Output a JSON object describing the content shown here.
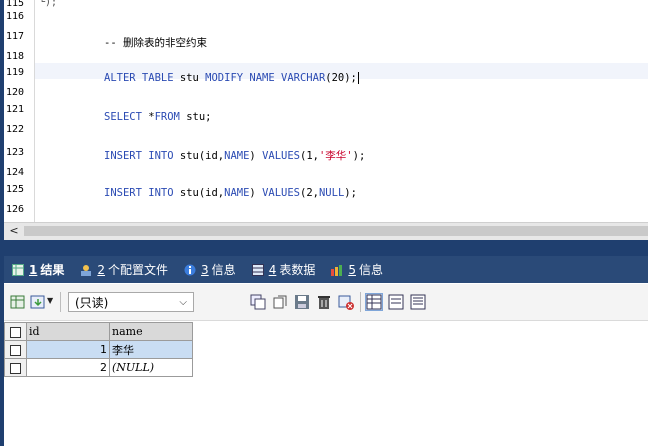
{
  "editor": {
    "line_numbers": [
      "115",
      "116",
      "117",
      "118",
      "119",
      "120",
      "121",
      "122",
      "123",
      "124",
      "125",
      "126"
    ],
    "fold_marker": "└);",
    "comment": "-- 删除表的非空约束",
    "alter": {
      "kw1": "ALTER TABLE",
      "t1": " stu ",
      "kw2": "MODIFY NAME VARCHAR",
      "t2": "(20);"
    },
    "select": {
      "kw": "SELECT",
      "t": " *",
      "kw2": "FROM",
      "t2": " stu;"
    },
    "insert1": {
      "kw": "INSERT INTO",
      "t": " stu(id,",
      "kw2": "NAME",
      "t2": ") ",
      "kw3": "VALUES",
      "t3": "(1,",
      "str": "'李华'",
      "t4": ");"
    },
    "insert2": {
      "kw": "INSERT INTO",
      "t": " stu(id,",
      "kw2": "NAME",
      "t2": ") ",
      "kw3": "VALUES",
      "t3": "(2,",
      "kw4": "NULL",
      "t4": ");"
    }
  },
  "scrollbar": {
    "left_arrow": "<"
  },
  "tabs": [
    {
      "num": "1",
      "label": "结果",
      "icon": "grid-result-icon"
    },
    {
      "num": "2",
      "label": "个配置文件",
      "icon": "profile-icon"
    },
    {
      "num": "3",
      "label": "信息",
      "icon": "info-icon"
    },
    {
      "num": "4",
      "label": "表数据",
      "icon": "table-data-icon"
    },
    {
      "num": "5",
      "label": "信息",
      "icon": "messages-icon"
    }
  ],
  "toolbar": {
    "readonly_label": "(只读)",
    "icons": [
      "export-grid-icon",
      "import-icon",
      "copy-rows-icon",
      "duplicate-icon",
      "save-icon",
      "delete-icon",
      "cancel-icon",
      "grid-view-icon",
      "form-view-icon",
      "text-view-icon"
    ]
  },
  "grid": {
    "columns": [
      "id",
      "name"
    ],
    "rows": [
      {
        "id": "1",
        "name": "李华",
        "selected": true
      },
      {
        "id": "2",
        "name": "(NULL)",
        "selected": false
      }
    ]
  },
  "colors": {
    "keyword": "#2b4bb3",
    "comment": "#178a3a",
    "string": "#c8002a",
    "tabbar": "#2a4a78"
  }
}
